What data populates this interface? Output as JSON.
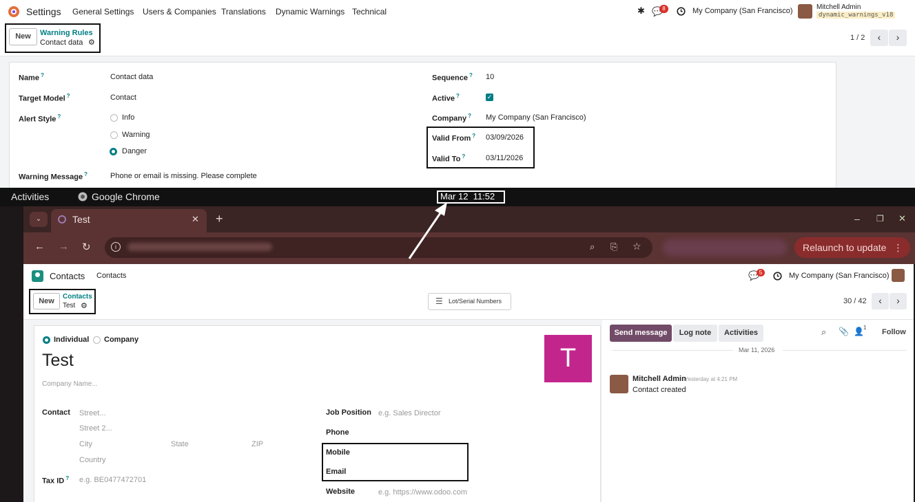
{
  "top": {
    "app_name": "Settings",
    "menu": [
      "General Settings",
      "Users & Companies",
      "Translations",
      "Dynamic Warnings",
      "Technical"
    ],
    "notif_count": "8",
    "company": "My Company (San Francisco)",
    "user_name": "Mitchell Admin",
    "db_name": "dynamic_warnings_v18",
    "new_label": "New",
    "breadcrumb_parent": "Warning Rules",
    "breadcrumb_current": "Contact data",
    "pager": "1 / 2",
    "fields": {
      "name_label": "Name",
      "name_value": "Contact data",
      "target_label": "Target Model",
      "target_value": "Contact",
      "alert_label": "Alert Style",
      "alert_options": [
        "Info",
        "Warning",
        "Danger"
      ],
      "alert_selected": "Danger",
      "message_label": "Warning Message",
      "message_value": "Phone or email is missing. Please complete",
      "sequence_label": "Sequence",
      "sequence_value": "10",
      "active_label": "Active",
      "active_value": true,
      "company_label": "Company",
      "company_value": "My Company (San Francisco)",
      "valid_from_label": "Valid From",
      "valid_from_value": "03/09/2026",
      "valid_to_label": "Valid To",
      "valid_to_value": "03/11/2026"
    }
  },
  "gnome": {
    "activities": "Activities",
    "app": "Google Chrome",
    "clock": "Mar 12  11:52"
  },
  "chrome": {
    "tab_title": "Test",
    "relaunch": "Relaunch to update"
  },
  "bottom": {
    "app_name": "Contacts",
    "menu_item": "Contacts",
    "notif_count": "5",
    "company": "My Company (San Francisco)",
    "new_label": "New",
    "breadcrumb_parent": "Contacts",
    "breadcrumb_current": "Test",
    "lot_button": "Lot/Serial Numbers",
    "pager": "30 / 42",
    "form": {
      "type_individual": "Individual",
      "type_company": "Company",
      "name": "Test",
      "avatar_letter": "T",
      "company_name_ph": "Company Name...",
      "contact_label": "Contact",
      "street_ph": "Street...",
      "street2_ph": "Street 2...",
      "city_ph": "City",
      "state_ph": "State",
      "zip_ph": "ZIP",
      "country_ph": "Country",
      "taxid_label": "Tax ID",
      "taxid_ph": "e.g. BE0477472701",
      "job_label": "Job Position",
      "job_ph": "e.g. Sales Director",
      "phone_label": "Phone",
      "mobile_label": "Mobile",
      "email_label": "Email",
      "website_label": "Website",
      "website_ph": "e.g. https://www.odoo.com"
    },
    "chatter": {
      "send_message": "Send message",
      "log_note": "Log note",
      "activities": "Activities",
      "followers_count": "1",
      "follow": "Follow",
      "date": "Mar 11, 2026",
      "author": "Mitchell Admin",
      "time": "Yesterday at 4:21 PM",
      "body": "Contact created"
    }
  },
  "colors": {
    "accent": "#017e84",
    "primary_button": "#714b67",
    "avatar_bg": "#c2268d",
    "badge": "#d9312b"
  }
}
